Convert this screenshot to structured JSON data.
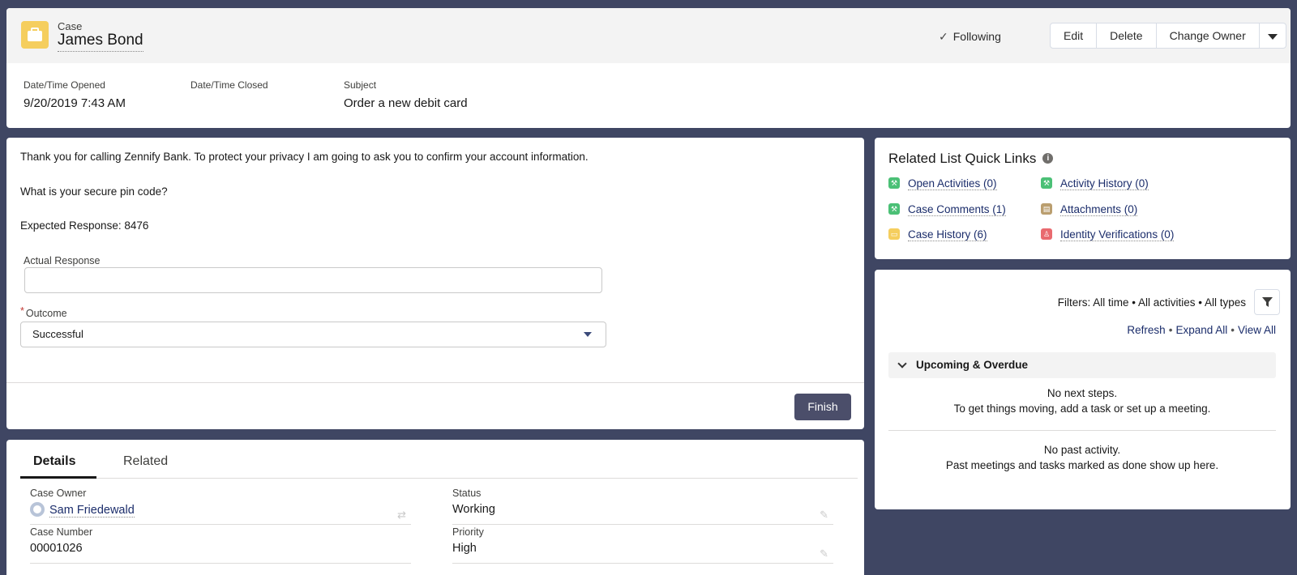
{
  "header": {
    "object_type": "Case",
    "record_name": "James Bond",
    "following_label": "Following",
    "buttons": {
      "edit": "Edit",
      "delete": "Delete",
      "change_owner": "Change Owner"
    },
    "highlights": [
      {
        "label": "Date/Time Opened",
        "value": "9/20/2019 7:43 AM"
      },
      {
        "label": "Date/Time Closed",
        "value": ""
      },
      {
        "label": "Subject",
        "value": "Order a new debit card"
      }
    ]
  },
  "flow": {
    "intro_text": "Thank you for calling Zennify Bank. To protect your privacy I am going to ask you to confirm your account information.",
    "question": "What is your secure pin code?",
    "expected_response": "Expected Response: 8476",
    "actual_response_label": "Actual Response",
    "actual_response_value": "",
    "outcome_label": "Outcome",
    "outcome_value": "Successful",
    "finish_label": "Finish"
  },
  "details": {
    "tabs": [
      "Details",
      "Related"
    ],
    "fields": [
      {
        "label": "Case Owner",
        "value": "Sam Friedewald"
      },
      {
        "label": "Status",
        "value": "Working"
      },
      {
        "label": "Case Number",
        "value": "00001026"
      },
      {
        "label": "Priority",
        "value": "High"
      }
    ]
  },
  "quick_links": {
    "title": "Related List Quick Links",
    "items": [
      {
        "label": "Open Activities (0)",
        "icon": "wrench-icon",
        "color": "#4bc076"
      },
      {
        "label": "Activity History (0)",
        "icon": "wrench-icon",
        "color": "#4bc076"
      },
      {
        "label": "Case Comments (1)",
        "icon": "wrench-icon",
        "color": "#4bc076"
      },
      {
        "label": "Attachments (0)",
        "icon": "file-icon",
        "color": "#ba9e6f"
      },
      {
        "label": "Case History (6)",
        "icon": "briefcase-icon",
        "color": "#f5ce5e"
      },
      {
        "label": "Identity Verifications (0)",
        "icon": "flask-icon",
        "color": "#e96a6f"
      }
    ]
  },
  "activity": {
    "filters": "Filters: All time • All activities • All types",
    "links": [
      "Refresh",
      "Expand All",
      "View All"
    ],
    "upcoming_label": "Upcoming & Overdue",
    "no_next_steps": "No next steps.",
    "no_next_hint": "To get things moving, add a task or set up a meeting.",
    "no_past": "No past activity.",
    "no_past_hint": "Past meetings and tasks marked as done show up here."
  },
  "colors": {
    "background": "#3f4663",
    "brand_button": "#4b4e6a",
    "link": "#1b2d6b",
    "case_icon": "#f5ce5e"
  }
}
